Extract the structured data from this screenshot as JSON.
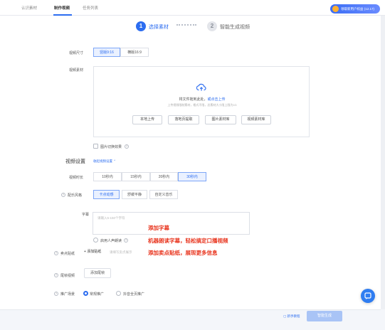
{
  "tabs": {
    "recognize": "认识素材",
    "make": "制作视频",
    "tasks": "任务列表"
  },
  "promo": {
    "label": "领取新用户权益 (12.17)"
  },
  "steps": {
    "step1_num": "1",
    "step1_label": "选择素材",
    "step2_num": "2",
    "step2_label": "智能生成视频"
  },
  "size": {
    "label": "视频尺寸",
    "opt1": "竖版9:16",
    "opt2": "横版16:9"
  },
  "material": {
    "label": "视频素材",
    "upload_text": "将文件拖到此处，",
    "upload_link": "或点击上传",
    "upload_hint": "上传视频限制素材，格式不限，总素材大小限上限为1G",
    "btn_local": "本地上传",
    "btn_page": "落地页提取",
    "btn_lib": "图片素材库",
    "btn_video": "视频素材库",
    "checkbox_label": "图片切换效果"
  },
  "settings": {
    "title": "视频设置",
    "link": "收起视频设置 ⌃"
  },
  "duration": {
    "label": "视频时长",
    "opts": [
      "10秒内",
      "15秒内",
      "20秒内",
      "30秒内"
    ]
  },
  "style": {
    "label": "配乐风格",
    "opts": [
      "卡点动感",
      "舒缓平静",
      "自定义音乐"
    ]
  },
  "subtitle": {
    "label": "字幕",
    "placeholder": "请输入5-150个字符",
    "checkbox_label": "启用人声朗读",
    "annotation1": "添加字幕",
    "annotation2": "机器朗读字幕，轻松搞定口播视频",
    "annotation3": "添加卖点贴纸，展现更多信息"
  },
  "sticker": {
    "label": "卖点贴纸",
    "add": "+ 添加贴纸",
    "placeholder": "请填写卖点展示"
  },
  "tail": {
    "label": "尾帧视频",
    "add": "添加尾帧"
  },
  "promo_scene": {
    "label": "推广场景",
    "opt1": "常规推广",
    "opt2": "抖音全页推广"
  },
  "footer": {
    "tutorial": "新手教程",
    "generate": "智能生成"
  },
  "colors": {
    "accent": "#2c6df0",
    "annotation": "#e8331c"
  }
}
